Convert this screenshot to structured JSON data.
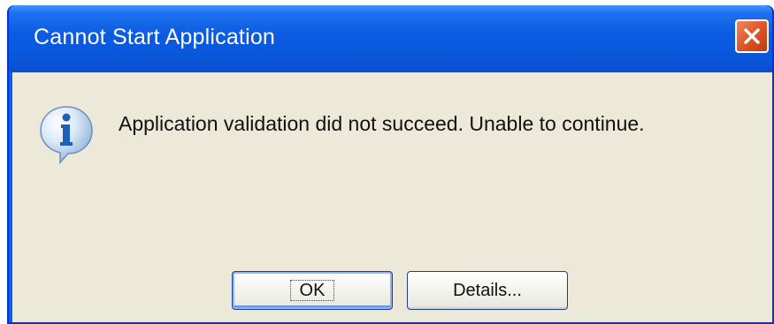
{
  "dialog": {
    "title": "Cannot Start Application",
    "message": "Application validation did not succeed. Unable to continue.",
    "icon": "information-icon",
    "buttons": {
      "ok_label": "OK",
      "details_label": "Details..."
    }
  },
  "colors": {
    "titlebar": "#0a58dc",
    "client_background": "#ece9d8",
    "close_button": "#e05a2c",
    "title_text": "#ffffff"
  }
}
